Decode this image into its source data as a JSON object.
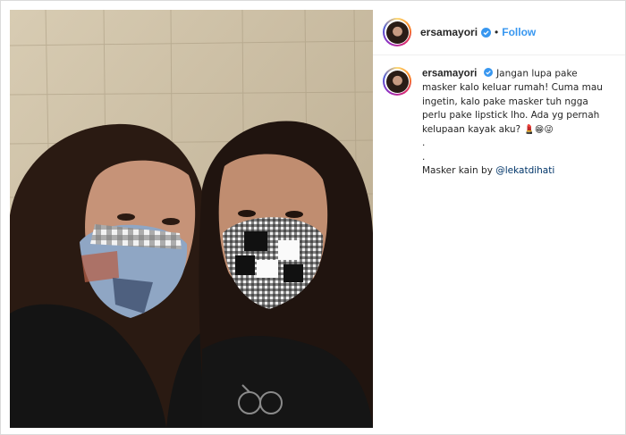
{
  "post": {
    "username": "ersamayori",
    "separator": "•",
    "follow_label": "Follow"
  },
  "caption": {
    "username": "ersamayori",
    "line1": "Jangan lupa pake",
    "line2": "masker kalo keluar rumah! Cuma mau",
    "line3": "ingetin, kalo pake masker tuh ngga",
    "line4": "perlu pake lipstick lho. Ada yg pernah",
    "line5": "kelupaan kayak aku?",
    "emojis": "💄😁😜",
    "dot1": ".",
    "dot2": ".",
    "masker_prefix": "Masker kain by",
    "mention": "@lekatdihati"
  },
  "icons": {
    "verified": "verified-badge-icon"
  },
  "colors": {
    "follow": "#3897f0",
    "verified": "#3897f0",
    "mention": "#003569",
    "text": "#262626"
  }
}
